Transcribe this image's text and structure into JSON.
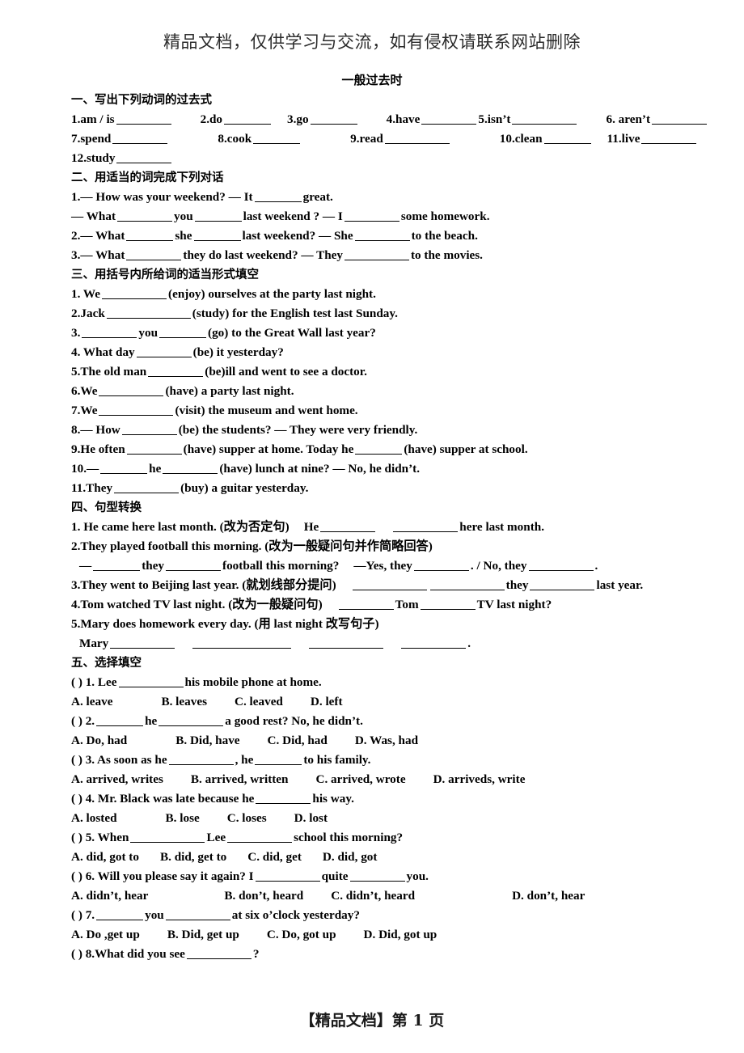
{
  "watermark": {
    "header": "精品文档，仅供学习与交流，如有侵权请联系网站删除",
    "footer": "【精品文档】第 1 页"
  },
  "title": "一般过去时",
  "sections": [
    {
      "heading": "一、写出下列动词的过去式",
      "lines": [
        "1.am / is ____ 2.do ____ 3.go ____ 4.have ____ 5.isn't ____ 6. aren't ____",
        "7.spend____ 8.cook____ 9.read ____ 10.clean ____ 11.live ____",
        "12.study____"
      ]
    },
    {
      "heading": "二、用适当的词完成下列对话",
      "lines": [
        "1.— How was your weekend? — It ____ great.",
        "— What ____ you ____ last weekend ? — I ____ some homework.",
        "2.— What ____ she ____ last weekend? — She ____ to the beach.",
        "3.— What ____ they do last weekend? — They ____ to the movies."
      ]
    },
    {
      "heading": "三、用括号内所给词的适当形式填空",
      "lines": [
        "1. We ____ (enjoy) ourselves at the party last night.",
        "2.Jack ____ (study) for the English test last Sunday.",
        "3.____ you ____ (go) to the Great Wall last year?",
        "4. What day ____ (be) it yesterday?",
        "5.The old man ____(be)ill and went to see a doctor.",
        "6.We ____ (have) a party last night.",
        "7.We ____ (visit) the museum and went home.",
        "8.— How ____ (be) the students? — They were very friendly.",
        "9.He often ____ (have) supper at home. Today he ____ (have) supper at school.",
        "10.— ____ he ____ (have) lunch at nine? — No, he didn't.",
        "11.They ____(buy) a guitar yesterday."
      ]
    },
    {
      "heading": "四、句型转换",
      "lines": [
        "1. He came here last month. (改为否定句)   He ____  ____ here last month.",
        "2.They played football this morning. (改为一般疑问句并作简略回答)",
        " —____ they ____ football this morning?   —Yes, they ____ . / No, they ____ .",
        "3.They went to Beijing last year. (就划线部分提问)  ____ ____ they ____ last year.",
        "4.Tom watched TV last night. (改为一般疑问句)   ____ Tom ____ TV last night?",
        "5.Mary does homework every day. (用  last night  改写句子)",
        " Mary ____  ____  ____  ____ ."
      ]
    },
    {
      "heading": "五、选择填空",
      "items": [
        {
          "stem": "(      ) 1. Lee ____ his mobile phone at home.",
          "options": "A. leave         B. leaves        C. leaved        D. left"
        },
        {
          "stem": "(      ) 2. ____ he ____ a good rest? No, he didn't.",
          "options": "A. Do, had         B. Did, have        C. Did, had        D. Was, had"
        },
        {
          "stem": "(      ) 3. As soon as he ____, he ____ to his family.",
          "options": "A. arrived, writes        B. arrived, written         C. arrived, wrote        D. arriveds, write"
        },
        {
          "stem": "(      ) 4. Mr. Black was late because he ____ his way.",
          "options": "A. losted          B. lose        C. loses         D. lost"
        },
        {
          "stem": "(      ) 5. When ____ Lee ____ school this morning?",
          "options": "A. did, got to  B. did, get to   C. did, get   D. did, got"
        },
        {
          "stem": "(      ) 6. Will you please say it again? I ____ quite ____ you.",
          "options": "A. didn't, hear            B. don't, heard       C. didn't, heard              D. don't, hear"
        },
        {
          "stem": "(      ) 7. ____ you ____ at six o'clock yesterday?",
          "options": "A. Do ,get up    B. Did, get up    C. Do, got up    D. Did, got up"
        },
        {
          "stem": "(      ) 8.What did you see ____?",
          "options": ""
        }
      ]
    }
  ],
  "s1": {
    "h": "一、写出下列动词的过去式",
    "r1a": "1.am / is",
    "r1b": "2.do",
    "r1c": "3.go",
    "r1d": "4.have",
    "r1e": "5.isn’t",
    "r1f": "6. aren’t",
    "r2a": "7.spend",
    "r2b": "8.cook",
    "r2c": "9.read",
    "r2d": "10.clean",
    "r2e": "11.live",
    "r3a": "12.study"
  },
  "s2": {
    "h": "二、用适当的词完成下列对话",
    "l1a": "1.— How was your weekend? — It",
    "l1b": "great.",
    "l2a": "— What",
    "l2b": "you",
    "l2c": "last weekend ? — I",
    "l2d": "some homework.",
    "l3a": "2.— What",
    "l3b": "she",
    "l3c": "last weekend? — She",
    "l3d": "to the beach.",
    "l4a": "3.— What",
    "l4b": "they do last weekend? — They",
    "l4c": "to the movies."
  },
  "s3": {
    "h": "三、用括号内所给词的适当形式填空",
    "l1a": "1. We",
    "l1b": "(enjoy) ourselves at the party last night.",
    "l2a": "2.Jack",
    "l2b": "(study) for the English test last Sunday.",
    "l3a": "3.",
    "l3b": "you",
    "l3c": "(go) to the Great Wall last year?",
    "l4a": "4. What day",
    "l4b": "(be) it yesterday?",
    "l5a": "5.The old man",
    "l5b": "(be)ill and went to see a doctor.",
    "l6a": "6.We",
    "l6b": "(have) a party last night.",
    "l7a": "7.We",
    "l7b": "(visit) the museum and went home.",
    "l8a": "8.— How",
    "l8b": "(be) the students? — They were very friendly.",
    "l9a": "9.He often",
    "l9b": "(have) supper at home. Today he",
    "l9c": "(have) supper at school.",
    "l10a": "10.—",
    "l10b": "he",
    "l10c": "(have) lunch at nine? — No, he didn’t.",
    "l11a": "11.They",
    "l11b": "(buy) a guitar yesterday."
  },
  "s4": {
    "h": "四、句型转换",
    "l1a": "1. He came here last month. (改为否定句)",
    "l1b": "He",
    "l1c": "here last month.",
    "l2a": "2.They played football this morning. (改为一般疑问句并作简略回答)",
    "l3a": "—",
    "l3b": "they",
    "l3c": "football this morning?",
    "l3d": "—Yes, they",
    "l3e": ". / No, they",
    "l3f": ".",
    "l4a": "3.They went to Beijing last year. (就划线部分提问)",
    "l4b": "they",
    "l4c": "last year.",
    "l5a": "4.Tom watched TV last night. (改为一般疑问句)",
    "l5b": "Tom",
    "l5c": "TV last night?",
    "l6a": "5.Mary does homework every day. (用  last night  改写句子)",
    "l7a": "Mary",
    "l7b": "."
  },
  "s5": {
    "h": "五、选择填空",
    "q1s_a": "(      ) 1. Lee",
    "q1s_b": "his mobile phone at home.",
    "q1o_a": "A. leave",
    "q1o_b": "B. leaves",
    "q1o_c": "C. leaved",
    "q1o_d": "D. left",
    "q2s_a": "(      ) 2.",
    "q2s_b": "he",
    "q2s_c": "a good rest? No, he didn’t.",
    "q2o_a": "A. Do, had",
    "q2o_b": "B. Did, have",
    "q2o_c": "C. Did, had",
    "q2o_d": "D. Was, had",
    "q3s_a": "(      ) 3. As soon as he",
    "q3s_b": ", he",
    "q3s_c": "to his family.",
    "q3o_a": "A. arrived, writes",
    "q3o_b": "B. arrived, written",
    "q3o_c": "C. arrived, wrote",
    "q3o_d": "D. arriveds, write",
    "q4s_a": "(      ) 4. Mr. Black was late because he",
    "q4s_b": "his way.",
    "q4o_a": "A. losted",
    "q4o_b": "B. lose",
    "q4o_c": "C. loses",
    "q4o_d": "D. lost",
    "q5s_a": "(      ) 5. When",
    "q5s_b": "Lee",
    "q5s_c": "school this morning?",
    "q5o_a": "A. did, got to",
    "q5o_b": "B. did, get to",
    "q5o_c": "C. did, get",
    "q5o_d": "D. did, got",
    "q6s_a": "(      ) 6. Will you please say it again? I",
    "q6s_b": "quite",
    "q6s_c": "you.",
    "q6o_a": "A. didn’t, hear",
    "q6o_b": "B. don’t, heard",
    "q6o_c": "C. didn’t, heard",
    "q6o_d": "D. don’t, hear",
    "q7s_a": "(      ) 7.",
    "q7s_b": "you",
    "q7s_c": "at six o’clock yesterday?",
    "q7o_a": "A. Do ,get up",
    "q7o_b": "B. Did, get up",
    "q7o_c": "C. Do, got up",
    "q7o_d": "D. Did, got up",
    "q8s_a": "(      ) 8.What did you see",
    "q8s_b": "?"
  }
}
